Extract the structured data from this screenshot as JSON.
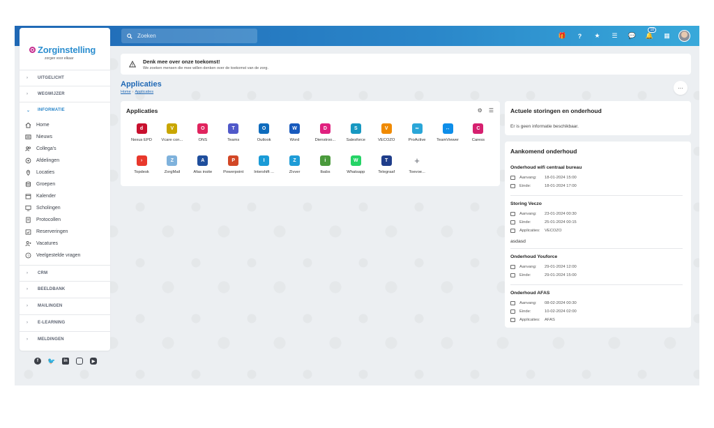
{
  "topbar": {
    "search_placeholder": "Zoeken",
    "notification_count": "18",
    "icons": [
      "gift-icon",
      "help-icon",
      "star-icon",
      "list-icon",
      "chat-icon",
      "bell-icon",
      "grid-icon"
    ]
  },
  "logo": {
    "title": "Zorginstelling",
    "subtitle": "zorgen voor elkaar"
  },
  "sidebar": {
    "sections_top": [
      "UITGELICHT",
      "WEGWIJZER"
    ],
    "open_section": "INFORMATIE",
    "items": [
      "Home",
      "Nieuws",
      "Collega's",
      "Afdelingen",
      "Locaties",
      "Groepen",
      "Kalender",
      "Scholingen",
      "Protocollen",
      "Reserveringen",
      "Vacatures",
      "Veelgestelde vragen"
    ],
    "sections_bottom": [
      "CRM",
      "BEELDBANK",
      "MAILINGEN",
      "E-LEARNING",
      "MELDINGEN"
    ]
  },
  "notice": {
    "title": "Denk mee over onze toekomst!",
    "text": "We zoeken mensen die mee willen denken over de toekomst van de zorg."
  },
  "page": {
    "title": "Applicaties",
    "breadcrumb": [
      "Home",
      "Applicaties"
    ]
  },
  "apps": {
    "title": "Applicaties",
    "items": [
      {
        "label": "Nexus EPD",
        "color": "#c8102e",
        "glyph": "d"
      },
      {
        "label": "Vcare con...",
        "color": "#c9a600",
        "glyph": "V"
      },
      {
        "label": "ONS",
        "color": "#e0245e",
        "glyph": "O"
      },
      {
        "label": "Teams",
        "color": "#5059c9",
        "glyph": "T"
      },
      {
        "label": "Outlook",
        "color": "#0f6cbd",
        "glyph": "O"
      },
      {
        "label": "Word",
        "color": "#185abd",
        "glyph": "W"
      },
      {
        "label": "Dienstroo...",
        "color": "#e0207f",
        "glyph": "D"
      },
      {
        "label": "Salesforce",
        "color": "#1798c1",
        "glyph": "S"
      },
      {
        "label": "VECOZO",
        "color": "#f08a00",
        "glyph": "V"
      },
      {
        "label": "ProActive",
        "color": "#2aa6d8",
        "glyph": "∞"
      },
      {
        "label": "TeamViewer",
        "color": "#0e8ee9",
        "glyph": "↔"
      },
      {
        "label": "Caress",
        "color": "#d6206f",
        "glyph": "C"
      },
      {
        "label": "Topdesk",
        "color": "#e8382c",
        "glyph": "›"
      },
      {
        "label": "ZorgMail",
        "color": "#7fb2dc",
        "glyph": "Z"
      },
      {
        "label": "Afas insite",
        "color": "#1f4e9c",
        "glyph": "A"
      },
      {
        "label": "Powerpoint",
        "color": "#d24726",
        "glyph": "P"
      },
      {
        "label": "Intershift ...",
        "color": "#1a9bd7",
        "glyph": "I"
      },
      {
        "label": "Zivver",
        "color": "#1e9cd7",
        "glyph": "Z"
      },
      {
        "label": "Ibabs",
        "color": "#4a9a3c",
        "glyph": "i"
      },
      {
        "label": "Whatsapp",
        "color": "#25d366",
        "glyph": "W"
      },
      {
        "label": "Telegraaf",
        "color": "#1f3d8a",
        "glyph": "T"
      },
      {
        "label": "Toevoe...",
        "color": "#5a5f68",
        "glyph": "+"
      }
    ]
  },
  "storingen": {
    "title": "Actuele storingen en onderhoud",
    "text": "Er is geen informatie beschikbaar."
  },
  "onderhoud": {
    "title": "Aankomend onderhoud",
    "labels": {
      "start": "Aanvang:",
      "end": "Einde:",
      "apps": "Applicaties:"
    },
    "items": [
      {
        "title": "Onderhoud wifi centraal bureau",
        "start": "18-01-2024 15:00",
        "end": "18-01-2024 17:00"
      },
      {
        "title": "Storing Veczo",
        "start": "23-01-2024 00:30",
        "end": "25-01-2024 00:15",
        "apps": "VECOZO",
        "desc": "asdasd"
      },
      {
        "title": "Onderhoud Youforce",
        "start": "29-01-2024 12:00",
        "end": "29-01-2024 15:00"
      },
      {
        "title": "Onderhoud AFAS",
        "start": "08-02-2024 00:30",
        "end": "10-02-2024 02:00",
        "apps": "AFAS"
      }
    ]
  },
  "socials": [
    "facebook-icon",
    "twitter-icon",
    "linkedin-icon",
    "instagram-icon",
    "youtube-icon"
  ]
}
